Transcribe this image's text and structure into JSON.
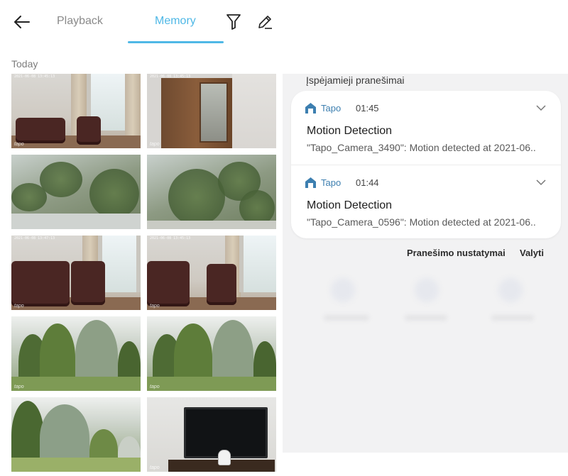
{
  "app": {
    "tabs": [
      {
        "label": "Playback",
        "active": false
      },
      {
        "label": "Memory",
        "active": true
      }
    ],
    "accent_color": "#4fb8e6",
    "section_label": "Today",
    "thumbnails": [
      {
        "scene": "living room with armchairs",
        "stamp": "2021-06-08 13:45:13",
        "logo": "tapo"
      },
      {
        "scene": "wooden cabinet",
        "stamp": "2021-06-08 13:45:13",
        "logo": "tapo"
      },
      {
        "scene": "window view of garden",
        "stamp": "",
        "logo": ""
      },
      {
        "scene": "window view of trees",
        "stamp": "",
        "logo": ""
      },
      {
        "scene": "living room with armchairs",
        "stamp": "2021-06-08 13:47:13",
        "logo": "tapo"
      },
      {
        "scene": "living room with armchairs",
        "stamp": "2021-06-08 13:45:13",
        "logo": "tapo"
      },
      {
        "scene": "garden trees",
        "stamp": "",
        "logo": "tapo"
      },
      {
        "scene": "garden trees",
        "stamp": "",
        "logo": "tapo"
      },
      {
        "scene": "garden trees",
        "stamp": "",
        "logo": ""
      },
      {
        "scene": "room with tv",
        "stamp": "",
        "logo": "tapo"
      }
    ]
  },
  "notifications": {
    "group_header": "Įspėjamieji pranešimai",
    "items": [
      {
        "app_name": "Tapo",
        "time": "01:45",
        "title": "Motion Detection",
        "body": "\"Tapo_Camera_3490\": Motion detected at 2021-06.."
      },
      {
        "app_name": "Tapo",
        "time": "01:44",
        "title": "Motion Detection",
        "body": "\"Tapo_Camera_0596\": Motion detected at 2021-06.."
      }
    ],
    "settings_label": "Pranešimo nustatymai",
    "clear_label": "Valyti",
    "app_icon_color": "#3d7fb0"
  }
}
